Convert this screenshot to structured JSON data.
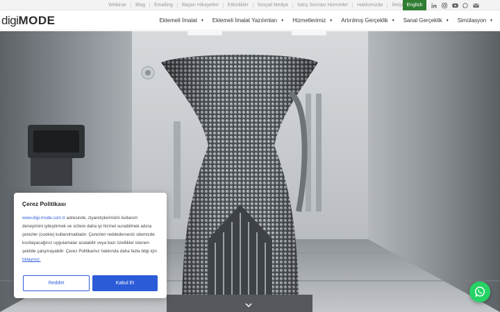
{
  "topbar": {
    "links": [
      "Webinar",
      "Blog",
      "Emailing",
      "Başarı Hikayeleri",
      "Etkinlikler",
      "Sosyal Medya",
      "Satış Sonrası Hizmetler",
      "Hakkımızda",
      "İletişim"
    ],
    "language_button": "English",
    "social_icons": [
      "linkedin-icon",
      "instagram-icon",
      "youtube-icon",
      "whatsapp-icon",
      "mail-icon"
    ]
  },
  "header": {
    "logo_part1": "digi",
    "logo_part2": "MODE",
    "nav": [
      {
        "label": "Eklemeli İmalat"
      },
      {
        "label": "Eklemeli İmalat Yazılımları"
      },
      {
        "label": "Hizmetlerimiz"
      },
      {
        "label": "Artırılmış Gerçeklik"
      },
      {
        "label": "Sanal Gerçeklik"
      },
      {
        "label": "Simülasyon"
      }
    ]
  },
  "cookie": {
    "title": "Çerez Politikası",
    "link": "www.digi-mode.com.tr",
    "text1": " adresinde, ziyaretçilerimizin kullanım deneyimini iyileştirmek ve sizlere daha iyi hizmet sunabilmek adına çerezler (cookie) kullanılmaktadır. Çerezleri reddederseniz sitemizde kısıtlayacağınız uygulamalar azalabilir veya bazı özellikler istenen şekilde çalışmayabilir. Çerez Politikamız hakkında daha fazla bilgi için ",
    "link2": "tıklayınız.",
    "reject": "Reddet",
    "accept": "Kabul Et"
  },
  "colors": {
    "accent": "#2b5bd7",
    "language_bg": "#2e7d32",
    "whatsapp": "#25d366"
  }
}
